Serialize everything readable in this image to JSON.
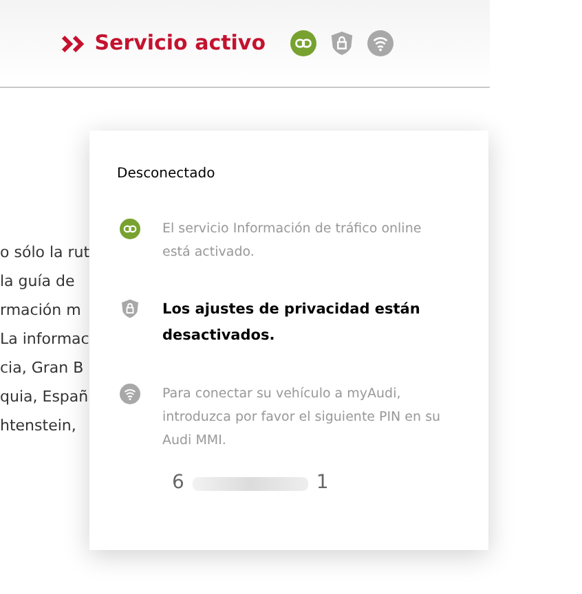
{
  "header": {
    "title": "Servicio activo",
    "status_icons": [
      {
        "kind": "link",
        "active": true
      },
      {
        "kind": "privacy",
        "active": false
      },
      {
        "kind": "wifi",
        "active": false
      }
    ]
  },
  "background_text": [
    "o sólo la rut",
    "la guía de",
    "rmación m",
    "La informac",
    "cia, Gran B",
    "quia, Españ",
    "htenstein,"
  ],
  "popup": {
    "heading": "Desconectado",
    "items": [
      {
        "kind": "link",
        "active": true,
        "emphasized": false,
        "text": "El servicio Información de tráfico online está activado."
      },
      {
        "kind": "privacy",
        "active": false,
        "emphasized": true,
        "text": "Los ajustes de privacidad están desactivados."
      },
      {
        "kind": "wifi",
        "active": false,
        "emphasized": false,
        "text": "Para conectar su vehículo a myAudi, introduzca por favor el siguiente PIN en su Audi MMI."
      }
    ],
    "pin": {
      "first": "6",
      "last": "1"
    }
  }
}
